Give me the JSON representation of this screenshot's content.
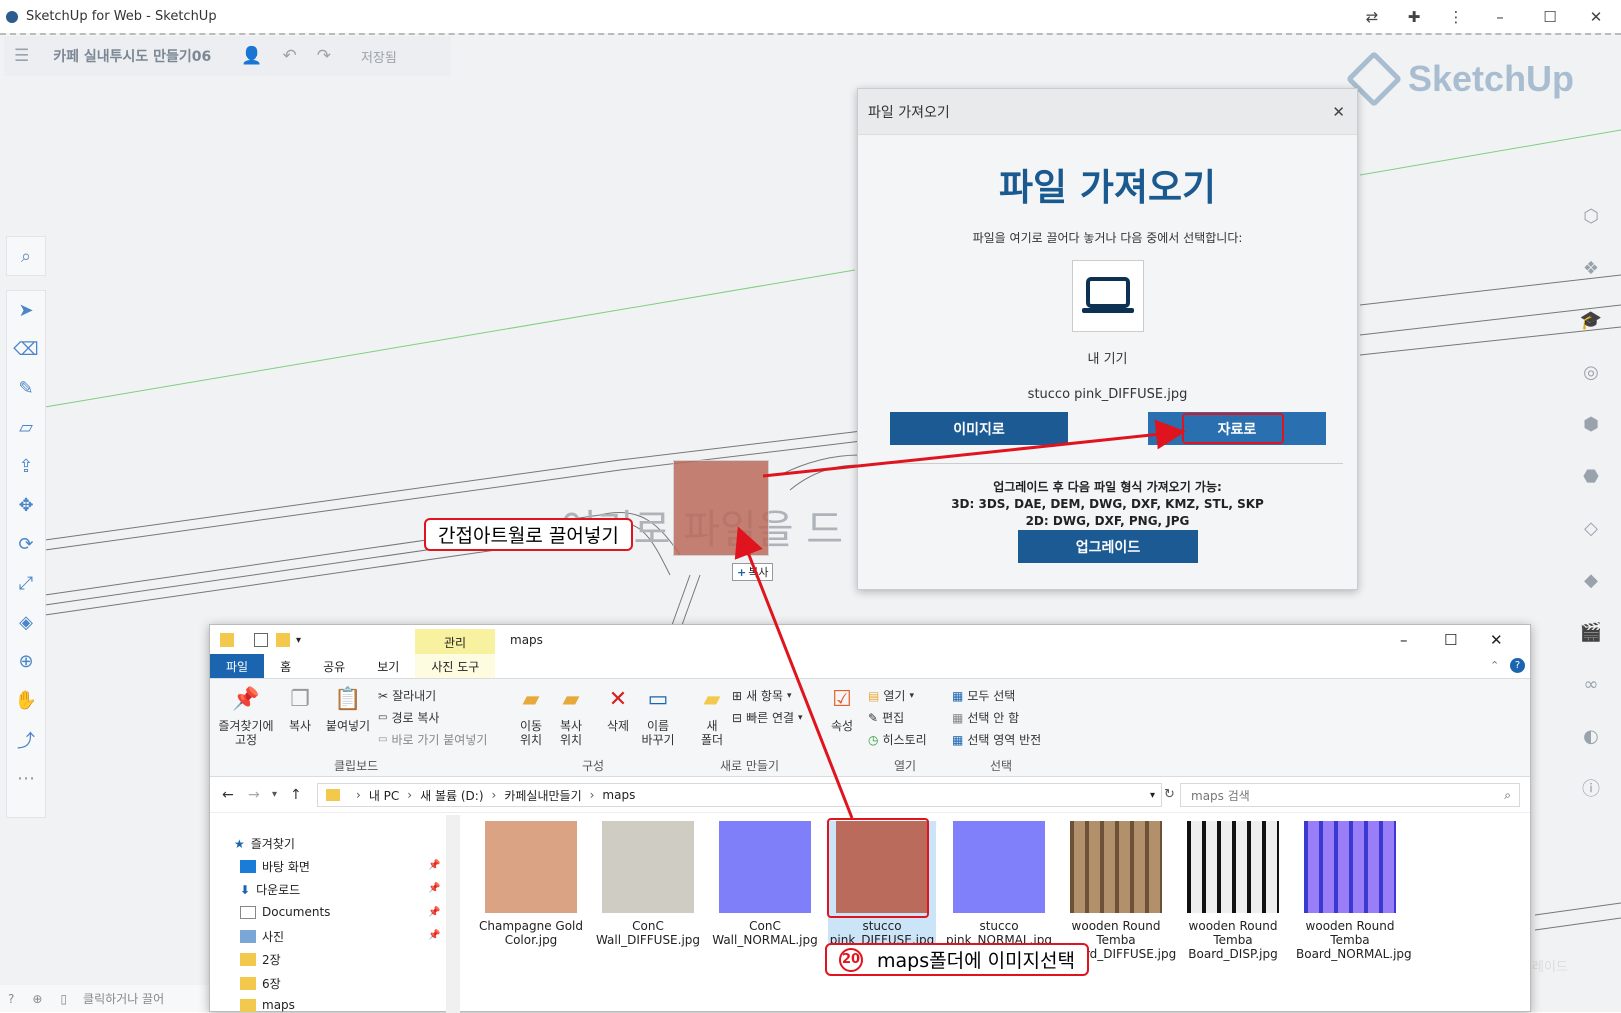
{
  "window": {
    "title": "SketchUp for Web - SketchUp"
  },
  "doc": {
    "title": "카페 실내투시도 만들기06",
    "save_label": "저장됨"
  },
  "brand": {
    "logo_text": "SketchUp"
  },
  "viewport": {
    "drop_hint": "여기로 파일을 드",
    "copy_badge": "복사",
    "status_text": "클릭하거나 끌어",
    "upgrade_corner": "레이드"
  },
  "dialog": {
    "header": "파일 가져오기",
    "heading": "파일 가져오기",
    "subtitle": "파일을 여기로 끌어다 놓거나 다음 중에서 선택합니다:",
    "device_label": "내 기기",
    "file_name": "stucco pink_DIFFUSE.jpg",
    "btn_image": "이미지로",
    "btn_material": "자료로",
    "upgrade_note": "업그레이드 후 다음 파일 형식 가져오기 가능:",
    "formats_3d": "3D:  3DS, DAE, DEM, DWG, DXF, KMZ, STL, SKP",
    "formats_2d": "2D:  DWG, DXF, PNG, JPG",
    "btn_upgrade": "업그레이드"
  },
  "explorer": {
    "title": "maps",
    "manage_tab": "관리",
    "tabs": [
      "파일",
      "홈",
      "공유",
      "보기",
      "사진 도구"
    ],
    "ribbon": {
      "pin": "즐겨찾기에\n고정",
      "copy": "복사",
      "paste": "붙여넣기",
      "cut": "잘라내기",
      "copy_path": "경로 복사",
      "paste_shortcut": "바로 가기 붙여넣기",
      "move_to": "이동\n위치",
      "copy_to": "복사\n위치",
      "delete": "삭제",
      "rename": "이름\n바꾸기",
      "new_folder": "새\n폴더",
      "new_item": "새 항목",
      "easy_access": "빠른 연결",
      "properties": "속성",
      "open": "열기",
      "edit": "편집",
      "history": "히스토리",
      "select_all": "모두 선택",
      "select_none": "선택 안 함",
      "invert": "선택 영역 반전",
      "groups": [
        "클립보드",
        "구성",
        "새로 만들기",
        "열기",
        "선택"
      ]
    },
    "path": [
      "내 PC",
      "새 볼륨 (D:)",
      "카페실내만들기",
      "maps"
    ],
    "search_placeholder": "maps 검색",
    "nav": [
      "즐겨찾기",
      "바탕 화면",
      "다운로드",
      "Documents",
      "사진",
      "2장",
      "6장",
      "maps"
    ],
    "files": [
      {
        "name": "Champagne Gold Color.jpg",
        "color": "#d9a384"
      },
      {
        "name": "ConC Wall_DIFFUSE.jpg",
        "color": "#cfccc4"
      },
      {
        "name": "ConC Wall_NORMAL.jpg",
        "color": "#7f7ff9"
      },
      {
        "name": "stucco pink_DIFFUSE.jpg",
        "color": "#bb6b5c"
      },
      {
        "name": "stucco pink_NORMAL.jpg",
        "color": "#8080fa"
      },
      {
        "name": "wooden Round Temba Board_DIFFUSE.jpg",
        "color": "#8f7052"
      },
      {
        "name": "wooden Round Temba Board_DISP.jpg",
        "color": "#888888"
      },
      {
        "name": "wooden Round Temba Board_NORMAL.jpg",
        "color": "#6f60f0"
      }
    ]
  },
  "annotations": {
    "drag_label": "간접아트월로 끌어넣기",
    "step_number": "20",
    "select_label": "maps폴더에 이미지선택"
  },
  "colors": {
    "accent": "#1c5a94",
    "annotation_red": "#e0141e",
    "explorer_file_tab": "#1a64b0"
  }
}
